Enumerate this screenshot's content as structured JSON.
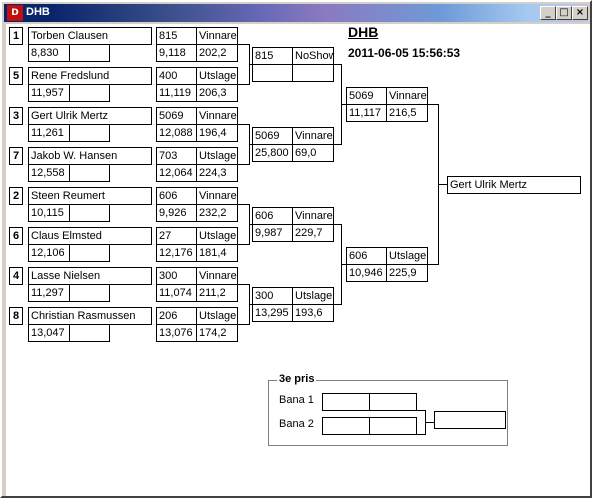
{
  "window": {
    "title": "DHB",
    "app_icon": "dhb-app-icon",
    "minimize": "_",
    "maximize": "□",
    "close": "×"
  },
  "header": {
    "title": "DHB",
    "datetime": "2011-06-05 15:56:53"
  },
  "round1": [
    {
      "seed": "1",
      "player": "Torben Clausen",
      "score": "8,830"
    },
    {
      "seed": "5",
      "player": "Rene Fredslund",
      "score": "11,957"
    },
    {
      "seed": "3",
      "player": "Gert Ulrik Mertz",
      "score": "11,261"
    },
    {
      "seed": "7",
      "player": "Jakob W. Hansen",
      "score": "12,558"
    },
    {
      "seed": "2",
      "player": "Steen Reumert",
      "score": "10,115"
    },
    {
      "seed": "6",
      "player": "Claus Elmsted",
      "score": "12,106"
    },
    {
      "seed": "4",
      "player": "Lasse Nielsen",
      "score": "11,297"
    },
    {
      "seed": "8",
      "player": "Christian Rasmussen",
      "score": "13,047"
    }
  ],
  "round1_results": [
    {
      "code": "815",
      "result": "Vinnare",
      "time": "9,118",
      "speed": "202,2"
    },
    {
      "code": "400",
      "result": "Utslagen",
      "time": "11,119",
      "speed": "206,3"
    },
    {
      "code": "5069",
      "result": "Vinnare",
      "time": "12,088",
      "speed": "196,4"
    },
    {
      "code": "703",
      "result": "Utslagen",
      "time": "12,064",
      "speed": "224,3"
    },
    {
      "code": "606",
      "result": "Vinnare",
      "time": "9,926",
      "speed": "232,2"
    },
    {
      "code": "27",
      "result": "Utslagen",
      "time": "12,176",
      "speed": "181,4"
    },
    {
      "code": "300",
      "result": "Vinnare",
      "time": "11,074",
      "speed": "211,2"
    },
    {
      "code": "206",
      "result": "Utslagen",
      "time": "13,076",
      "speed": "174,2"
    }
  ],
  "round2": [
    {
      "code": "815",
      "result": "NoShow",
      "time": "",
      "speed": ""
    },
    {
      "code": "5069",
      "result": "Vinnare",
      "time": "25,800",
      "speed": "69,0"
    },
    {
      "code": "606",
      "result": "Vinnare",
      "time": "9,987",
      "speed": "229,7"
    },
    {
      "code": "300",
      "result": "Utslagen",
      "time": "13,295",
      "speed": "193,6"
    }
  ],
  "semifinal": [
    {
      "code": "5069",
      "result": "Vinnare",
      "time": "11,117",
      "speed": "216,5"
    },
    {
      "code": "606",
      "result": "Utslagen",
      "time": "10,946",
      "speed": "225,9"
    }
  ],
  "winner": "Gert Ulrik Mertz",
  "third_place": {
    "legend": "3e pris",
    "lane1": "Bana 1",
    "lane2": "Bana 2"
  }
}
